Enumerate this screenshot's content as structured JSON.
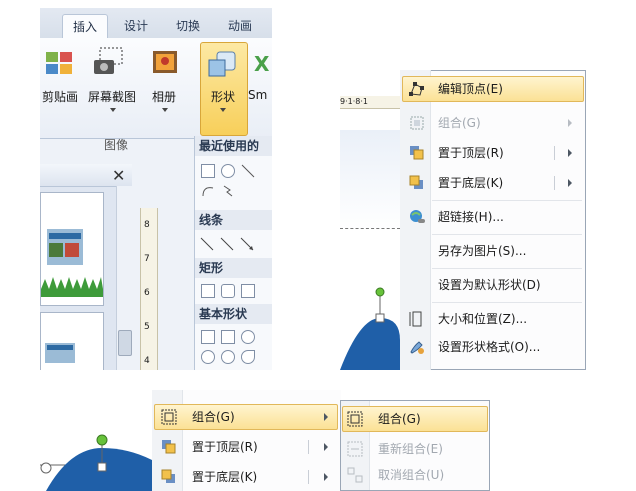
{
  "ribbon": {
    "tabs": [
      {
        "label": "插入",
        "active": true
      },
      {
        "label": "设计",
        "active": false
      },
      {
        "label": "切换",
        "active": false
      },
      {
        "label": "动画",
        "active": false
      }
    ],
    "buttons": {
      "clip_art": "剪贴画",
      "screenshot": "屏幕截图",
      "album": "相册",
      "shapes": "形状",
      "smartart": "Sm"
    },
    "group_label": "图像",
    "gallery": {
      "recent": "最近使用的",
      "lines": "线条",
      "rectangles": "矩形",
      "basic_shapes": "基本形状"
    },
    "ruler_marks": [
      "8",
      "7",
      "6",
      "5",
      "4"
    ]
  },
  "context_menu": {
    "ruler_text": "9·1·8·1",
    "items": [
      {
        "label": "编辑顶点(E)",
        "icon": "edit-points-icon",
        "highlighted": true,
        "disabled": false,
        "submenu": false
      },
      {
        "label": "组合(G)",
        "icon": "group-icon",
        "highlighted": false,
        "disabled": true,
        "submenu": true
      },
      {
        "label": "置于顶层(R)",
        "icon": "bring-to-front-icon",
        "highlighted": false,
        "disabled": false,
        "submenu": true
      },
      {
        "label": "置于底层(K)",
        "icon": "send-to-back-icon",
        "highlighted": false,
        "disabled": false,
        "submenu": true
      },
      {
        "label": "超链接(H)...",
        "icon": "hyperlink-icon",
        "highlighted": false,
        "disabled": false,
        "submenu": false
      },
      {
        "label": "另存为图片(S)...",
        "icon": "",
        "highlighted": false,
        "disabled": false,
        "submenu": false
      },
      {
        "label": "设置为默认形状(D)",
        "icon": "",
        "highlighted": false,
        "disabled": false,
        "submenu": false
      },
      {
        "label": "大小和位置(Z)...",
        "icon": "size-position-icon",
        "highlighted": false,
        "disabled": false,
        "submenu": false
      },
      {
        "label": "设置形状格式(O)...",
        "icon": "format-shape-icon",
        "highlighted": false,
        "disabled": false,
        "submenu": false
      }
    ]
  },
  "submenu_panel": {
    "parent_items": [
      {
        "label": "组合(G)",
        "highlighted": true
      },
      {
        "label": "置于顶层(R)",
        "highlighted": false
      },
      {
        "label": "置于底层(K)",
        "highlighted": false
      }
    ],
    "sub_items": [
      {
        "label": "组合(G)",
        "highlighted": true,
        "disabled": false
      },
      {
        "label": "重新组合(E)",
        "highlighted": false,
        "disabled": true
      },
      {
        "label": "取消组合(U)",
        "highlighted": false,
        "disabled": true
      }
    ]
  },
  "colors": {
    "highlight": "#fbe195",
    "shape_fill": "#1f5fa8",
    "handle_green": "#67c23a"
  }
}
